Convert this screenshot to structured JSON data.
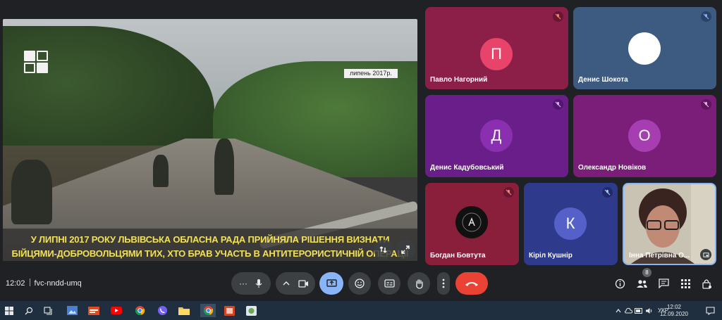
{
  "presentation": {
    "date_tag": "липень 2017р.",
    "caption_line1": "У ЛИПНІ 2017 РОКУ ЛЬВІВСЬКА ОБЛАСНА РАДА ПРИЙНЯЛА РІШЕННЯ ВИЗНАТИ",
    "caption_line2": "БІЙЦЯМИ-ДОБРОВОЛЬЦЯМИ ТИХ, ХТО БРАВ УЧАСТЬ В АНТИТЕРОРИСТИЧНІЙ ОПЕРАЦІЇ"
  },
  "participants": [
    {
      "name": "Павло Нагорний",
      "initial": "П",
      "tile_color": "#8c1f48",
      "avatar_color": "#e8436b",
      "mic": "muted"
    },
    {
      "name": "Денис Шокота",
      "initial": "",
      "tile_color": "#3d5a80",
      "avatar_color": "#ffffff",
      "mic": "muted"
    },
    {
      "name": "Денис Кадубовський",
      "initial": "Д",
      "tile_color": "#6a1e8a",
      "avatar_color": "#8a2fb0",
      "mic": "muted"
    },
    {
      "name": "Олександр Новіков",
      "initial": "О",
      "tile_color": "#7a1e7a",
      "avatar_color": "#a63db0",
      "mic": "muted"
    },
    {
      "name": "Богдан Бовтута",
      "initial": "",
      "tile_color": "#8a1f3c",
      "avatar_color": "#111111",
      "mic": "muted"
    },
    {
      "name": "Кіріл Кушнір",
      "initial": "К",
      "tile_color": "#2e3a8c",
      "avatar_color": "#5561c9",
      "mic": "muted"
    },
    {
      "name": "Інна Петрівна О...",
      "initial": "",
      "tile_color": "#b9b3a4",
      "avatar_color": "",
      "mic": "on"
    }
  ],
  "meeting": {
    "time": "12:02",
    "code": "fvc-nndd-umq",
    "participant_count": "8"
  },
  "taskbar": {
    "lang": "УКР",
    "clock_time": "12:02",
    "clock_date": "12.09.2020"
  },
  "colors": {
    "background": "#202124",
    "control": "#3c4043",
    "present_active": "#8ab4f8",
    "end_call": "#ea4335",
    "caption_text": "#f1e15a",
    "mic_muted": "#d93025"
  }
}
